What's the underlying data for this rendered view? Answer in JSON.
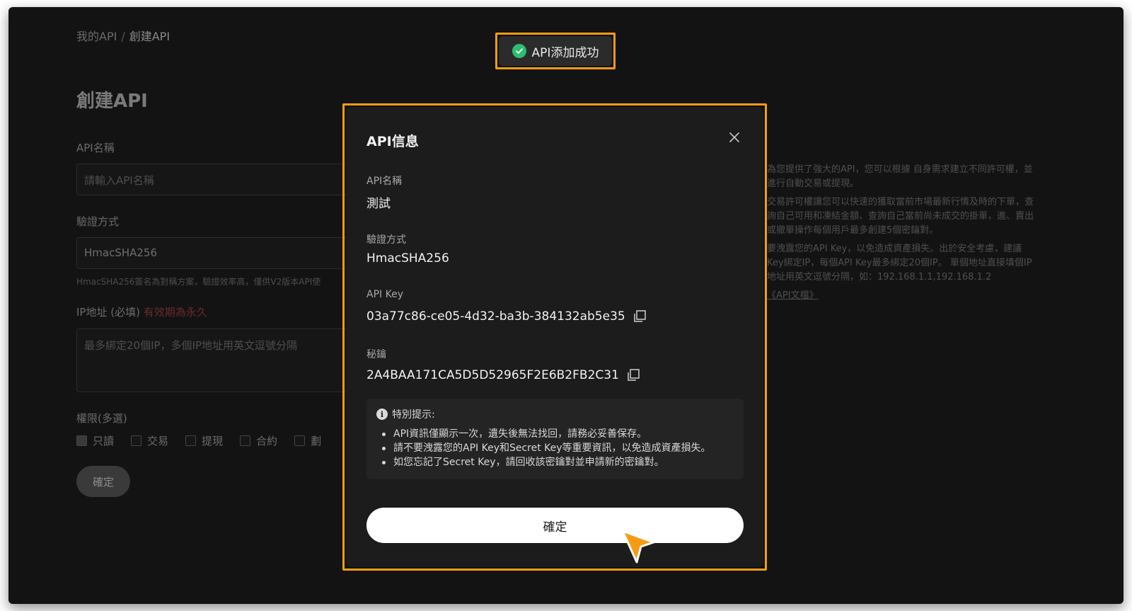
{
  "breadcrumb": {
    "parent": "我的API",
    "separator": "/",
    "current": "創建API"
  },
  "page": {
    "title": "創建API",
    "name_label": "API名稱",
    "name_placeholder": "請輸入API名稱",
    "auth_label": "驗證方式",
    "auth_value": "HmacSHA256",
    "auth_hint": "HmacSHA256簽名為對稱方案，驗證效率高，僅供V2版本API使",
    "ip_label": "IP地址 (必填)",
    "ip_note": "有效期為永久",
    "ip_placeholder": "最多綁定20個IP，多個IP地址用英文逗號分隔",
    "perm_label": "權限(多選)",
    "permissions": [
      {
        "label": "只讀",
        "checked": true
      },
      {
        "label": "交易",
        "checked": false
      },
      {
        "label": "提現",
        "checked": false
      },
      {
        "label": "合約",
        "checked": false
      },
      {
        "label": "劃",
        "checked": false
      }
    ],
    "confirm_label": "確定",
    "right_text": [
      "為您提供了強大的API，您可以根據 自身需求建立不同許可權，並進行自動交易或提現。",
      "交易許可權讓您可以快速的獲取當前市場最新行情及時的下單，查詢自己可用和凍結金額、查詢自己當前尚未成交的掛單，進、賣出或撤單操作每個用戶最多創建5個密鑰對。",
      "要洩露您的API Key，以免造成資產損失。出於安全考慮，建議Key綁定IP，每個API Key最多綁定20個IP。 單個地址直接填個IP地址用英文逗號分隔，如：192.168.1.1,192.168.1.2"
    ],
    "right_link": "《API文檔》"
  },
  "toast": {
    "text": "API添加成功",
    "icon": "check-circle-icon",
    "color": "#2dbd6e"
  },
  "modal": {
    "title": "API信息",
    "fields": [
      {
        "label": "API名稱",
        "value": "測試",
        "copyable": false
      },
      {
        "label": "驗證方式",
        "value": "HmacSHA256",
        "copyable": false
      },
      {
        "label": "API Key",
        "value": "03a77c86-ce05-4d32-ba3b-384132ab5e35",
        "copyable": true
      },
      {
        "label": "秘鑰",
        "value": "2A4BAA171CA5D5D52965F2E6B2FB2C31",
        "copyable": true
      }
    ],
    "notice_title": "特別提示:",
    "notice_items": [
      "API資訊僅顯示一次，遺失後無法找回，請務必妥善保存。",
      "請不要洩露您的API Key和Secret Key等重要資訊，以免造成資產損失。",
      "如您忘記了Secret Key，請回收該密鑰對並申請新的密鑰對。"
    ],
    "confirm_label": "確定"
  },
  "colors": {
    "highlight": "#f59c12",
    "success": "#2dbd6e"
  }
}
